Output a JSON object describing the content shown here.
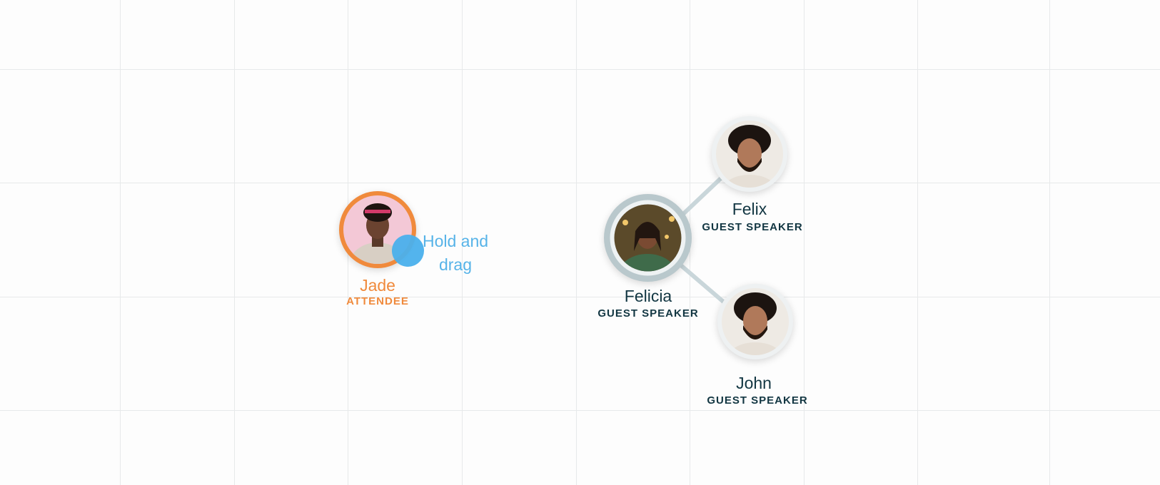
{
  "hint": {
    "line1": "Hold and",
    "line2": "drag"
  },
  "people": {
    "jade": {
      "name": "Jade",
      "role": "ATTENDEE"
    },
    "felicia": {
      "name": "Felicia",
      "role": "GUEST SPEAKER"
    },
    "felix": {
      "name": "Felix",
      "role": "GUEST SPEAKER"
    },
    "john": {
      "name": "John",
      "role": "GUEST SPEAKER"
    }
  },
  "colors": {
    "attendee_accent": "#f08a3c",
    "speaker_text": "#123642",
    "drag_handle": "#4ab0ec",
    "hint_text": "#56b3e8",
    "connector": "#c9d6da"
  }
}
